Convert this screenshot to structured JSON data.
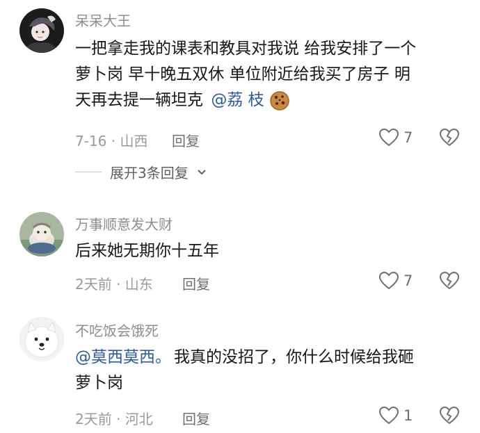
{
  "comments": [
    {
      "username": "呆呆大王",
      "content_line1": "一把拿走我的课表和教具对我说 给我安排了一个",
      "content_line2": "萝卜岗 早十晚五双休 单位附近给我买了房子 明",
      "content_line3_prefix": "天再去提一辆坦克 ",
      "mention": "@荔 枝",
      "meta": "7-16 · 山西",
      "reply_label": "回复",
      "likes": "7",
      "expand_label": "展开3条回复",
      "avatar_icon": "girl-avatar",
      "emoji_icon": "cookie-emoji"
    },
    {
      "username": "万事顺意发大财",
      "content": "后来她无期你十五年",
      "meta": "2天前 · 山东",
      "reply_label": "回复",
      "likes": "7",
      "avatar_icon": "cartoon-avatar"
    },
    {
      "username": "不吃饭会饿死",
      "mention": "@莫西莫西。",
      "content_line1_suffix": "我真的没招了，你什么时候给我砸",
      "content_line2": "萝卜岗",
      "meta": "2天前 · 河北",
      "reply_label": "回复",
      "likes": "1",
      "avatar_icon": "samoyed-dog-avatar"
    }
  ],
  "colors": {
    "username": "#8e8e8e",
    "mention": "#2b5aa3",
    "meta": "#9a9a9a",
    "icon": "#6f6f6f"
  }
}
